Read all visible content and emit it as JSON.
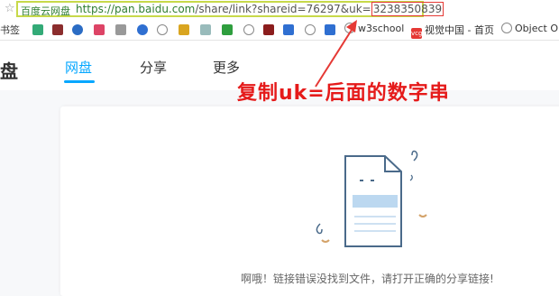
{
  "address_bar": {
    "site_tag": "百度云网盘",
    "url_main": "https://pan.baidu.com",
    "url_rest": "/share/link?shareid=76297&uk=",
    "uk_value": "3238350839"
  },
  "bookmarks": {
    "items": [
      {
        "label": "书签",
        "icon": "bookmark-icon"
      },
      {
        "label": "w3school",
        "icon": "globe-icon"
      },
      {
        "label": "视觉中国 - 首页",
        "icon": "vcg-icon"
      },
      {
        "label": "Object O",
        "icon": "globe-icon"
      }
    ]
  },
  "header": {
    "logo": "盘",
    "tabs": [
      {
        "label": "网盘",
        "active": true
      },
      {
        "label": "分享",
        "active": false
      },
      {
        "label": "更多",
        "active": false
      }
    ]
  },
  "annotation": {
    "text": "复制uk=后面的数字串",
    "color": "#e51a1a"
  },
  "content": {
    "error_message": "啊哦！链接错误没找到文件，请打开正确的分享链接!"
  },
  "colors": {
    "accent": "#06a7ff",
    "url_green": "#2e7d32",
    "highlight_box": "#c7d94a"
  }
}
